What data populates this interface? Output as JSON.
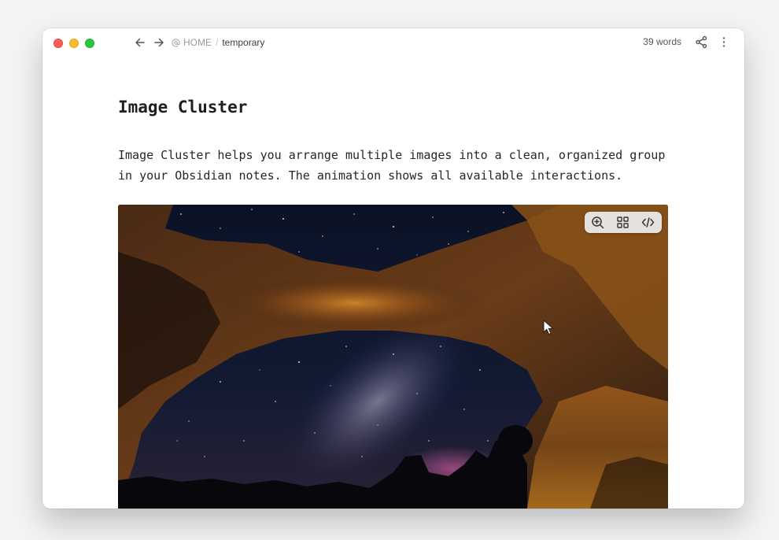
{
  "window": {
    "traffic_lights": {
      "close_color": "#ff5f57",
      "minimize_color": "#febc2e",
      "zoom_color": "#28c840"
    },
    "nav": {
      "back_icon": "arrow-left-icon",
      "forward_icon": "arrow-right-icon"
    },
    "breadcrumb": {
      "root": "HOME",
      "separator": "/",
      "current": "temporary",
      "root_icon": "at-sign-icon"
    },
    "word_count": "39 words",
    "actions": {
      "share_icon": "share-icon",
      "more_icon": "more-vertical-icon"
    }
  },
  "note": {
    "title": "Image Cluster",
    "paragraph": "Image Cluster helps you arrange multiple images into a clean, organized group in your Obsidian notes. The animation shows all available interactions.",
    "image": {
      "subject": "night sky stone arch with milky way",
      "toolbar": [
        {
          "name": "zoom-in",
          "icon": "zoom-in-icon"
        },
        {
          "name": "grid",
          "icon": "grid-icon"
        },
        {
          "name": "code",
          "icon": "code-icon"
        }
      ]
    }
  },
  "colors": {
    "background": "#ffffff",
    "text": "#262626",
    "muted": "#9a9a9a",
    "toolbar_bg": "#eeeeee"
  }
}
